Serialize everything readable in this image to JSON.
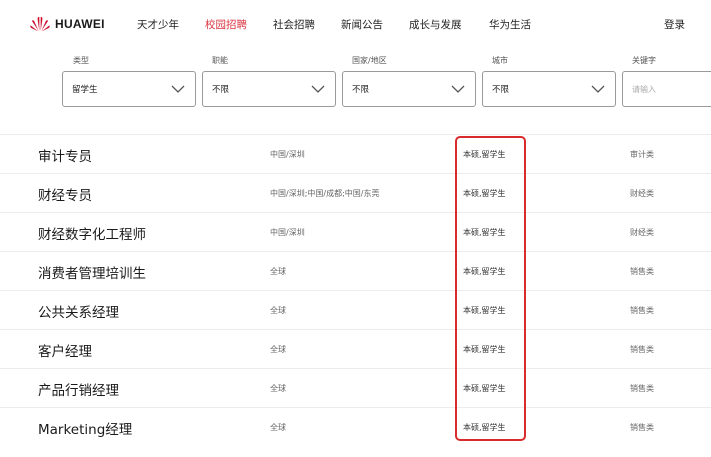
{
  "brand": {
    "name": "HUAWEI",
    "logo_color": "#cf0a2c"
  },
  "nav": {
    "items": [
      {
        "label": "天才少年",
        "active": false
      },
      {
        "label": "校园招聘",
        "active": true
      },
      {
        "label": "社会招聘",
        "active": false
      },
      {
        "label": "新闻公告",
        "active": false
      },
      {
        "label": "成长与发展",
        "active": false
      },
      {
        "label": "华为生活",
        "active": false
      }
    ],
    "login": "登录",
    "active_color": "#d9333f"
  },
  "filters": {
    "type": {
      "label": "类型",
      "value": "留学生"
    },
    "role": {
      "label": "职能",
      "value": "不限"
    },
    "country": {
      "label": "国家/地区",
      "value": "不限"
    },
    "city": {
      "label": "城市",
      "value": "不限"
    },
    "keyword": {
      "label": "关键字",
      "placeholder": "请输入"
    }
  },
  "jobs": [
    {
      "title": "审计专员",
      "location": "中国/深圳",
      "education": "本硕,留学生",
      "category": "审计类"
    },
    {
      "title": "财经专员",
      "location": "中国/深圳;中国/成都;中国/东莞",
      "education": "本硕,留学生",
      "category": "财经类"
    },
    {
      "title": "财经数字化工程师",
      "location": "中国/深圳",
      "education": "本硕,留学生",
      "category": "财经类"
    },
    {
      "title": "消费者管理培训生",
      "location": "全球",
      "education": "本硕,留学生",
      "category": "销售类"
    },
    {
      "title": "公共关系经理",
      "location": "全球",
      "education": "本硕,留学生",
      "category": "销售类"
    },
    {
      "title": "客户经理",
      "location": "全球",
      "education": "本硕,留学生",
      "category": "销售类"
    },
    {
      "title": "产品行销经理",
      "location": "全球",
      "education": "本硕,留学生",
      "category": "销售类"
    },
    {
      "title": "Marketing经理",
      "location": "全球",
      "education": "本硕,留学生",
      "category": "销售类"
    }
  ],
  "highlight_color": "#d92b2b"
}
